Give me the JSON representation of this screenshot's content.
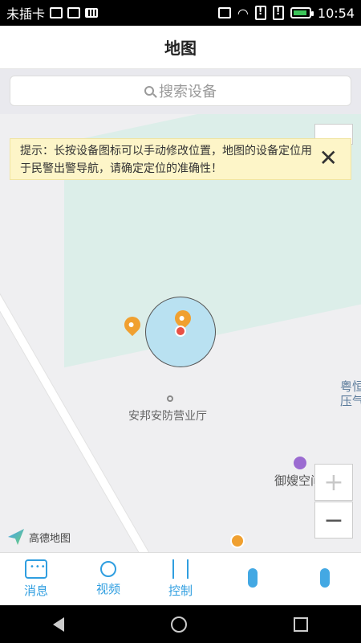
{
  "statusbar": {
    "carrier": "未插卡",
    "time": "10:54"
  },
  "header": {
    "title": "地图"
  },
  "search": {
    "placeholder": "搜索设备"
  },
  "tip": {
    "text": "提示：长按设备图标可以手动修改位置，地图的设备定位用于民警出警导航，请确定定位的准确性！",
    "close_glyph": "✕"
  },
  "map": {
    "poi_main": "安邦安防营业厅",
    "poi_right": "粤恒压气",
    "poi_shop": "御嫂空间",
    "zoom_in": "+",
    "zoom_out": "−",
    "logo": "高德地图"
  },
  "bottom_nav": {
    "items": [
      {
        "label": "消息",
        "icon": "message-icon"
      },
      {
        "label": "视频",
        "icon": "camera-icon"
      },
      {
        "label": "控制",
        "icon": "sliders-icon"
      },
      {
        "label": "",
        "icon": "location-icon"
      },
      {
        "label": "",
        "icon": "settings-icon"
      }
    ]
  },
  "colors": {
    "accent": "#2f9ee0",
    "tip_bg": "#fdf5c8",
    "circle_fill": "#b9e1f1",
    "marker": "#f0a030"
  }
}
